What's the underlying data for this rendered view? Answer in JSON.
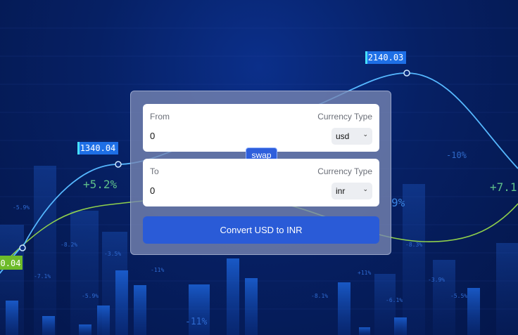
{
  "background": {
    "tags": [
      "2140.03",
      "1340.04",
      "0.04"
    ],
    "percentages": [
      "+5.2%",
      "-10%",
      "+7.1",
      "9%",
      "-11%",
      "-11%",
      "-5.9%",
      "-8.2%",
      "-3.5%",
      "-7.1%",
      "+11%",
      "-8.1%",
      "-5.5%",
      "-3.9%",
      "-8.3%",
      "-5.9%",
      "-6.1%"
    ]
  },
  "converter": {
    "from": {
      "label": "From",
      "currency_type_label": "Currency Type",
      "amount": "0",
      "currency": "usd"
    },
    "swap_label": "swap",
    "to": {
      "label": "To",
      "currency_type_label": "Currency Type",
      "amount": "0",
      "currency": "inr"
    },
    "convert_label": "Convert USD to INR"
  },
  "icons": {
    "dropdown": "chevron-down-icon"
  },
  "colors": {
    "accent": "#2a5bd7",
    "tag_blue": "#1e6fe6",
    "tag_green": "#6dbb2a"
  }
}
